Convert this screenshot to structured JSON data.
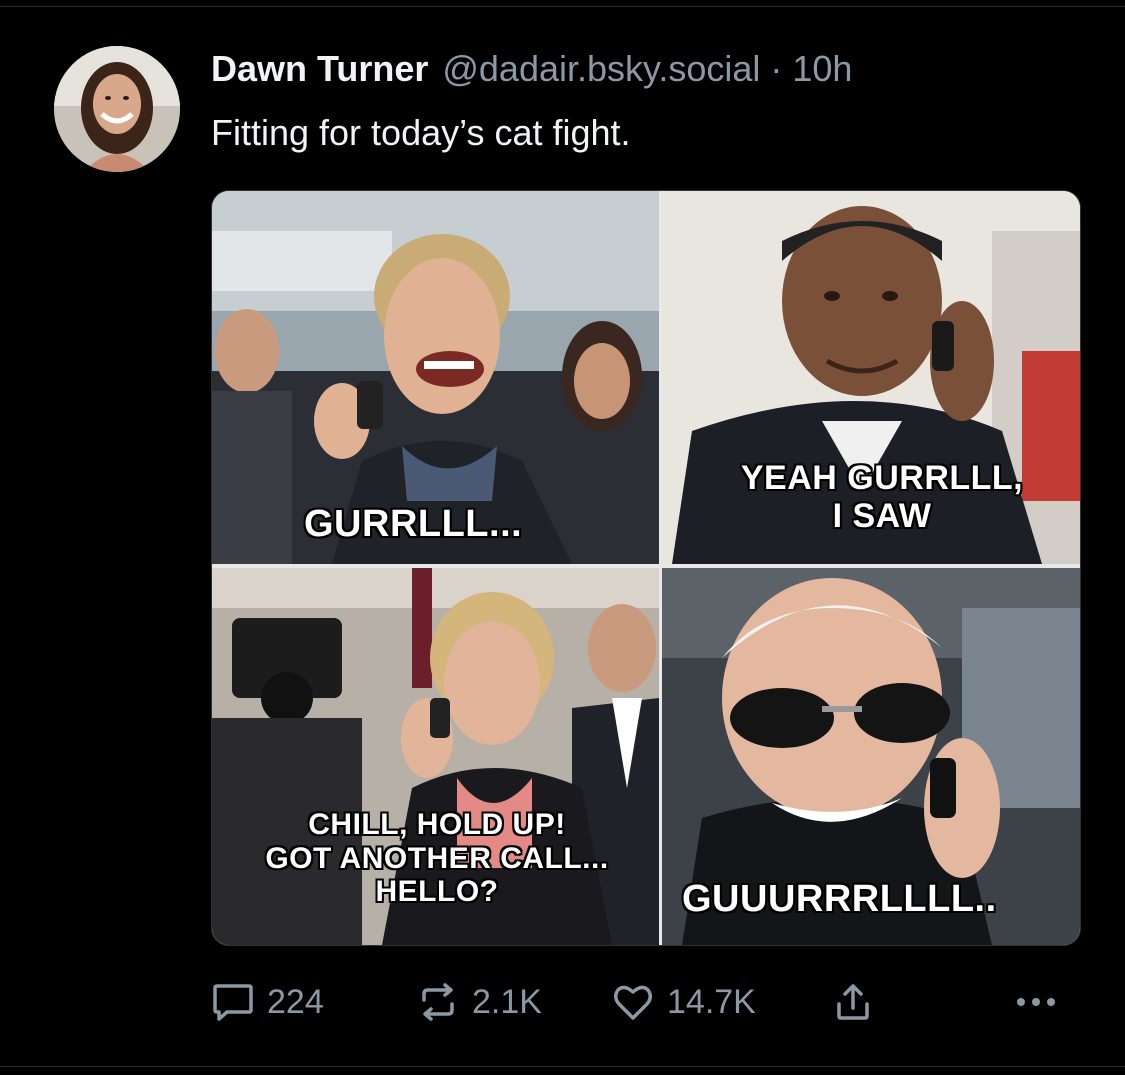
{
  "post": {
    "author_name": "Dawn Turner",
    "handle": "@dadair.bsky.social",
    "separator": "·",
    "time": "10h",
    "text": "Fitting for today’s cat fight."
  },
  "media": {
    "captions": {
      "panel1": "GURRLLL...",
      "panel2_line1": "YEAH GURRLLL,",
      "panel2_line2": "I SAW",
      "panel3_line1": "CHILL, HOLD UP!",
      "panel3_line2": "GOT ANOTHER CALL...",
      "panel3_line3": "HELLO?",
      "panel4": "GUUURRRLLLL.."
    }
  },
  "actions": {
    "reply_count": "224",
    "repost_count": "2.1K",
    "like_count": "14.7K",
    "reply_icon": "speech-bubble-icon",
    "repost_icon": "repost-arrows-icon",
    "like_icon": "heart-icon",
    "share_icon": "share-upload-icon",
    "more_icon": "ellipsis-icon"
  },
  "colors": {
    "background": "#000000",
    "primary_text": "#f1f3f5",
    "secondary_text": "#8b98a5"
  }
}
